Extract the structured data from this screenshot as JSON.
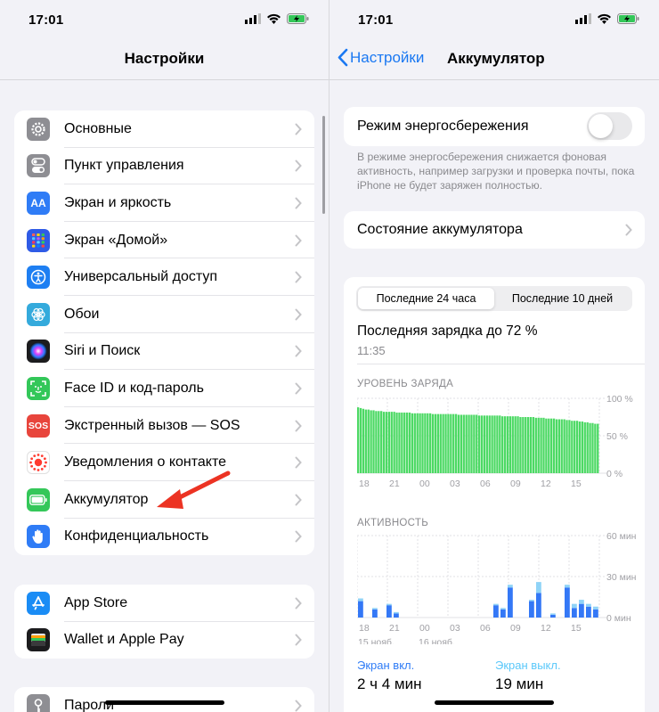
{
  "left": {
    "time": "17:01",
    "title": "Настройки",
    "group1": [
      {
        "label": "Основные",
        "icon": "gear-icon",
        "color": "#8e8e93"
      },
      {
        "label": "Пункт управления",
        "icon": "toggles-icon",
        "color": "#8e8e93"
      },
      {
        "label": "Экран и яркость",
        "icon": "text-size-icon",
        "color": "#2f7cf6"
      },
      {
        "label": "Экран «Домой»",
        "icon": "home-grid-icon",
        "color": "#2f5be6"
      },
      {
        "label": "Универсальный доступ",
        "icon": "accessibility-icon",
        "color": "#1e7ff2"
      },
      {
        "label": "Обои",
        "icon": "flower-icon",
        "color": "#34aadc"
      },
      {
        "label": "Siri и Поиск",
        "icon": "siri-icon",
        "color": "#1c1c1e"
      },
      {
        "label": "Face ID и код-пароль",
        "icon": "faceid-icon",
        "color": "#33c759"
      },
      {
        "label": "Экстренный вызов — SOS",
        "icon": "sos-icon",
        "color": "#e8453c"
      },
      {
        "label": "Уведомления о контакте",
        "icon": "exposure-icon",
        "color": "#ffffff"
      },
      {
        "label": "Аккумулятор",
        "icon": "battery-icon",
        "color": "#34c759"
      },
      {
        "label": "Конфиденциальность",
        "icon": "hand-icon",
        "color": "#2f7cf6"
      }
    ],
    "group2": [
      {
        "label": "App Store",
        "icon": "appstore-icon",
        "color": "#1a8cf5"
      },
      {
        "label": "Wallet и Apple Pay",
        "icon": "wallet-icon",
        "color": "#1c1c1e"
      }
    ],
    "group3": [
      {
        "label": "Пароли",
        "icon": "key-icon",
        "color": "#8e8e93"
      }
    ],
    "sos_text": "SOS"
  },
  "right": {
    "time": "17:01",
    "back_label": "Настройки",
    "title": "Аккумулятор",
    "low_power_label": "Режим энергосбережения",
    "low_power_on": false,
    "low_power_note": "В режиме энергосбережения снижается фоновая активность, например загрузки и проверка почты, пока iPhone не будет заряжен полностью.",
    "battery_health_label": "Состояние аккумулятора",
    "seg_24h": "Последние 24 часа",
    "seg_10d": "Последние 10 дней",
    "last_charge": "Последняя зарядка до 72 %",
    "last_charge_time": "11:35",
    "level_title": "УРОВЕНЬ ЗАРЯДА",
    "activity_title": "АКТИВНОСТЬ",
    "screen_on_label": "Экран вкл.",
    "screen_on_value": "2 ч 4 мин",
    "screen_off_label": "Экран выкл.",
    "screen_off_value": "19 мин"
  },
  "chart_data": [
    {
      "type": "bar",
      "title": "УРОВЕНЬ ЗАРЯДА",
      "y_ticks": [
        "100 %",
        "50 %",
        "0 %"
      ],
      "x_ticks": [
        "18",
        "21",
        "00",
        "03",
        "06",
        "09",
        "12",
        "15"
      ],
      "ylim": [
        0,
        100
      ],
      "values": [
        88,
        87,
        86,
        85,
        85,
        84,
        84,
        83,
        83,
        83,
        82,
        82,
        82,
        82,
        82,
        81,
        81,
        81,
        81,
        81,
        81,
        80,
        80,
        80,
        80,
        80,
        80,
        80,
        80,
        79,
        79,
        79,
        79,
        79,
        79,
        79,
        79,
        79,
        79,
        78,
        78,
        78,
        78,
        78,
        78,
        78,
        78,
        77,
        77,
        77,
        77,
        77,
        77,
        77,
        77,
        77,
        76,
        76,
        76,
        76,
        76,
        76,
        76,
        75,
        75,
        75,
        75,
        75,
        75,
        74,
        74,
        74,
        74,
        73,
        73,
        73,
        73,
        72,
        72,
        72,
        72,
        71,
        71,
        70,
        70,
        70,
        69,
        69,
        68,
        68,
        67,
        67,
        66,
        66
      ],
      "color": "#4cd964"
    },
    {
      "type": "bar",
      "title": "АКТИВНОСТЬ",
      "y_ticks": [
        "60 мин",
        "30 мин",
        "0 мин"
      ],
      "x_ticks": [
        "18",
        "21",
        "00",
        "03",
        "06",
        "09",
        "12",
        "15"
      ],
      "x_dates": [
        "15 нояб.",
        "16 нояб."
      ],
      "ylim": [
        0,
        60
      ],
      "series": [
        {
          "name": "Экран вкл.",
          "values": [
            12,
            0,
            6,
            0,
            9,
            3,
            0,
            0,
            0,
            0,
            0,
            0,
            0,
            0,
            0,
            0,
            0,
            0,
            0,
            9,
            6,
            22,
            0,
            0,
            12,
            18,
            0,
            2,
            0,
            22,
            7,
            10,
            8,
            6
          ],
          "color": "#3478f6"
        },
        {
          "name": "Экран выкл.",
          "values": [
            2,
            0,
            1,
            0,
            1,
            1,
            0,
            0,
            0,
            0,
            0,
            0,
            0,
            0,
            0,
            0,
            0,
            0,
            0,
            1,
            1,
            2,
            0,
            0,
            1,
            8,
            0,
            1,
            0,
            2,
            3,
            3,
            2,
            2
          ],
          "color": "#8fd3f7"
        }
      ]
    }
  ]
}
